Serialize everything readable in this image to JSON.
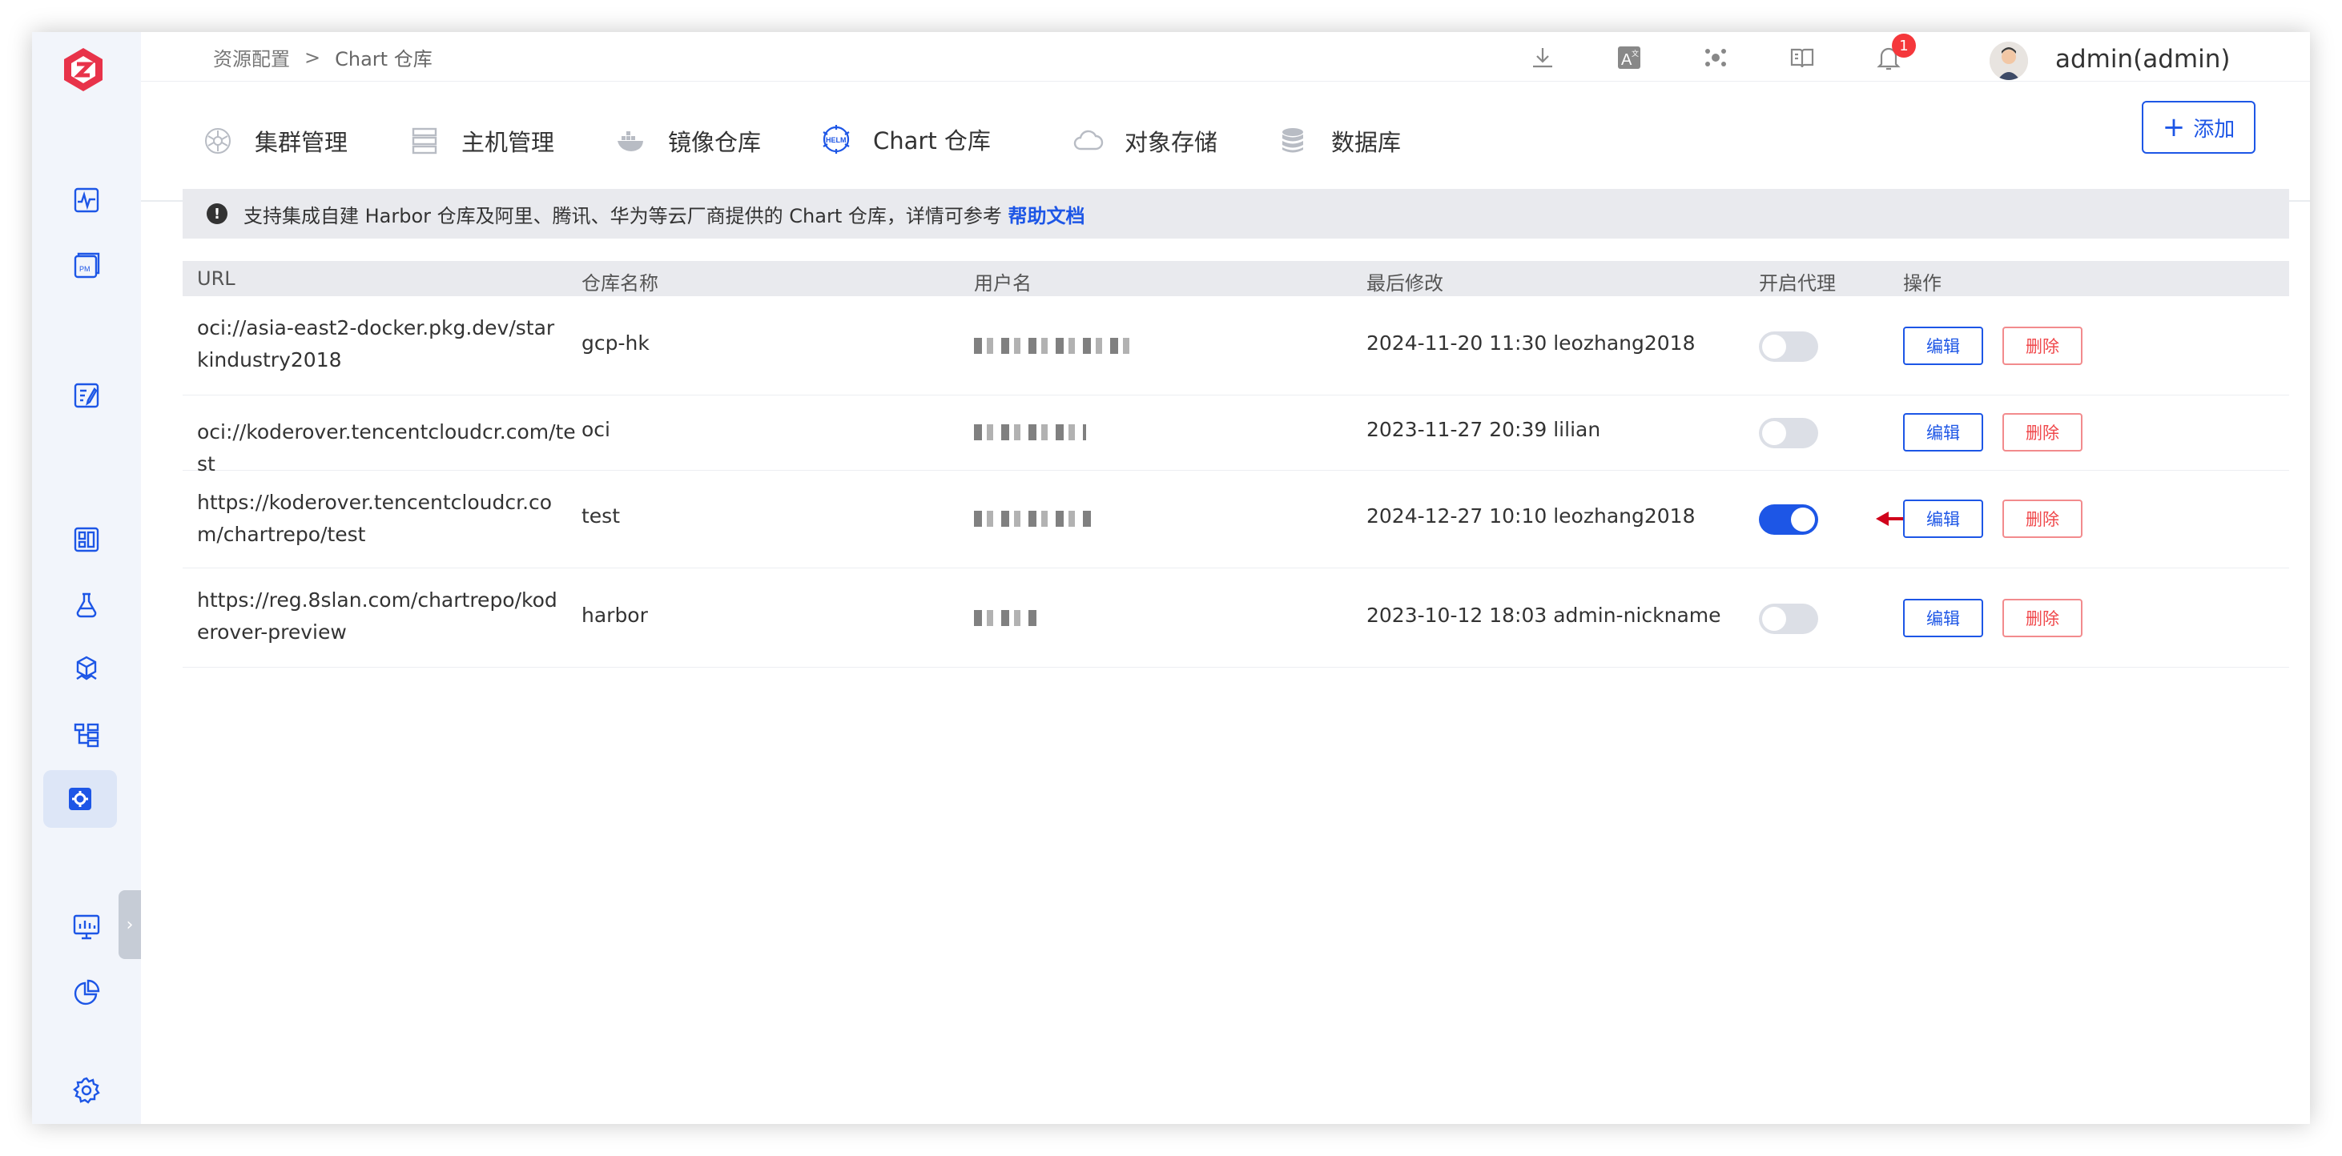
{
  "breadcrumb": {
    "parent": "资源配置",
    "separator": ">",
    "current": "Chart 仓库"
  },
  "header": {
    "notification_count": "1",
    "username": "admin(admin)"
  },
  "tabs": [
    {
      "label": "集群管理"
    },
    {
      "label": "主机管理"
    },
    {
      "label": "镜像仓库"
    },
    {
      "label": "Chart 仓库",
      "active": true
    },
    {
      "label": "对象存储"
    },
    {
      "label": "数据库"
    }
  ],
  "add_button": {
    "label": "添加"
  },
  "notice": {
    "text": "支持集成自建 Harbor 仓库及阿里、腾讯、华为等云厂商提供的 Chart 仓库，详情可参考",
    "link": "帮助文档"
  },
  "table": {
    "columns": [
      "URL",
      "仓库名称",
      "用户名",
      "最后修改",
      "开启代理",
      "操作"
    ],
    "rows": [
      {
        "url": "oci://asia-east2-docker.pkg.dev/starkindustry2018",
        "name": "gcp-hk",
        "modified": "2024-11-20 11:30 leozhang2018",
        "proxy": false,
        "edit": "编辑",
        "delete": "删除"
      },
      {
        "url": "oci://koderover.tencentcloudcr.com/test",
        "name": "oci",
        "modified": "2023-11-27 20:39 lilian",
        "proxy": false,
        "edit": "编辑",
        "delete": "删除"
      },
      {
        "url": "https://koderover.tencentcloudcr.com/chartrepo/test",
        "name": "test",
        "modified": "2024-12-27 10:10 leozhang2018",
        "proxy": true,
        "edit": "编辑",
        "delete": "删除"
      },
      {
        "url": "https://reg.8slan.com/chartrepo/koderover-preview",
        "name": "harbor",
        "modified": "2023-10-12 18:03 admin-nickname",
        "proxy": false,
        "edit": "编辑",
        "delete": "删除"
      }
    ]
  },
  "colors": {
    "accent": "#1d56e6",
    "danger": "#f0484b",
    "brand": "#e8334a"
  }
}
